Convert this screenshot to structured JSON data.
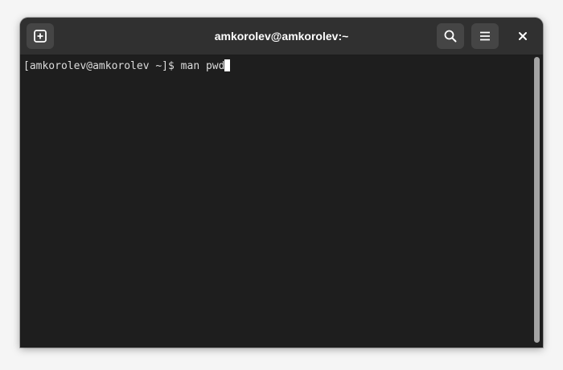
{
  "window": {
    "title": "amkorolev@amkorolev:~"
  },
  "headerbar": {
    "buttons": [
      {
        "icon": "new-tab-icon"
      },
      {
        "icon": "search-icon"
      },
      {
        "icon": "hamburger-menu-icon"
      },
      {
        "icon": "close-icon"
      }
    ]
  },
  "terminal": {
    "prompt": "[amkorolev@amkorolev ~]$ ",
    "command": "man pwd",
    "background": "#1e1e1e",
    "foreground": "#dcdcdc"
  },
  "colors": {
    "headerbar": "#303030",
    "button": "#454545",
    "scrollbar_thumb": "#a4a4a4"
  }
}
